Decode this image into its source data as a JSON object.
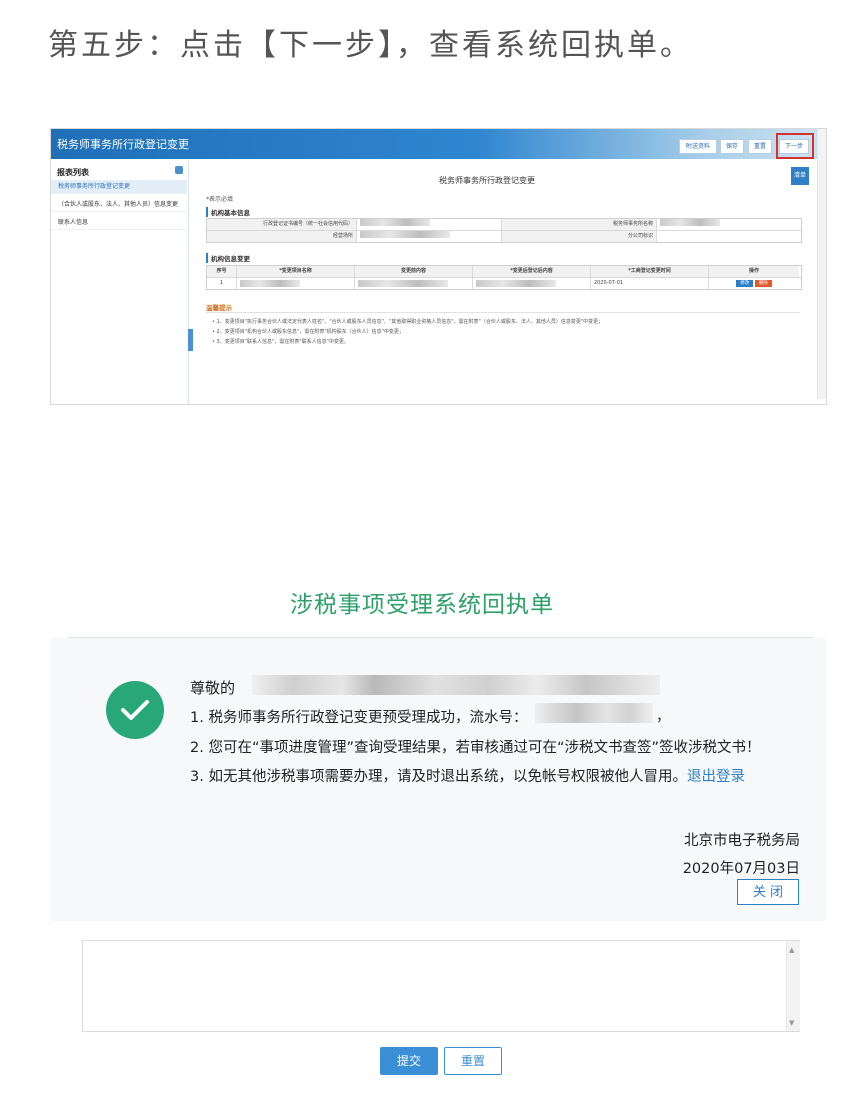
{
  "step": {
    "title": "第五步：点击【下一步】，查看系统回执单。"
  },
  "app": {
    "window_title": "税务师事务所行政登记变更",
    "toolbar": {
      "attach": "附送资料",
      "save": "保存",
      "reset": "重置",
      "next": "下一步"
    },
    "sidebar": {
      "heading": "报表列表",
      "items": [
        {
          "label": "税务师事务所行政登记变更"
        },
        {
          "label": "（合伙人或股东、法人、其他人员）信息变更"
        },
        {
          "label": "联系人信息"
        }
      ]
    },
    "main": {
      "title": "税务师事务所行政登记变更",
      "side_button": "清单",
      "required_note": "*表示必填",
      "basic_info": {
        "heading": "机构基本信息",
        "rows": [
          {
            "label_left": "行政登记证书编号（统一社会信用代码）",
            "label_right": "税务师事务所名称"
          },
          {
            "label_left": "经营场所",
            "label_right": "分公司标识"
          }
        ]
      },
      "change_info": {
        "heading": "机构信息变更",
        "columns": [
          "序号",
          "*变更项目名称",
          "变更前内容",
          "*变更后登记后内容",
          "*工商登记变更时间",
          "操作"
        ],
        "rows": [
          {
            "index": "1",
            "date": "2020-07-01",
            "edit": "修改",
            "delete": "删除"
          }
        ]
      },
      "tips": {
        "heading": "温馨提示",
        "items": [
          "• 1、变更项目\"执行事务合伙人或法定代表人姓名\"、\"合伙人或股东人员信息\"、\"其他取得职业资格人员信息\"，需在附表\"（合伙人或股东、法人、其他人员）信息变更\"中变更；",
          "• 2、变更项目\"机构合伙人或股东信息\"，需在附表\"机构股东（合伙人）信息\"中变更；",
          "• 3、变更项目\"联系人信息\"，需在附表\"联系人信息\"中变更。"
        ]
      }
    }
  },
  "receipt": {
    "title": "涉税事项受理系统回执单",
    "greeting": "尊敬的",
    "line1": "1. 税务师事务所行政登记变更预受理成功，流水号：",
    "line1_suffix": "，",
    "line2": "2. 您可在“事项进度管理”查询受理结果，若审核通过可在“涉税文书查签”签收涉税文书！",
    "line3": "3. 如无其他涉税事项需要办理，请及时退出系统，以免帐号权限被他人冒用。",
    "logout_link": "退出登录",
    "org": "北京市电子税务局",
    "date": "2020年07月03日",
    "close_button": "关闭"
  },
  "form_bottom": {
    "submit": "提交",
    "reset": "重置"
  },
  "colors": {
    "accent": "#2f7fc7",
    "success": "#28a878",
    "title_green": "#2ea06a",
    "highlight_red": "#d0342c"
  }
}
